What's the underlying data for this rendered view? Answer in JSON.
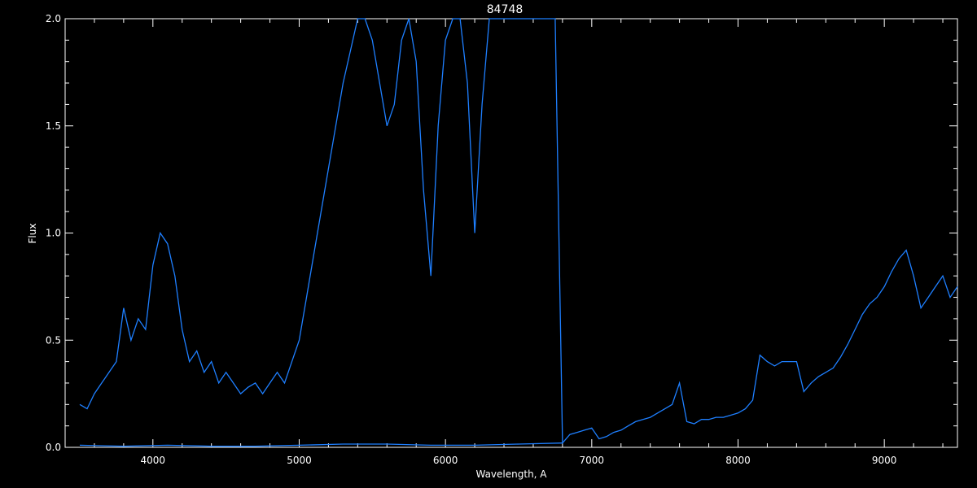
{
  "chart_data": {
    "type": "line",
    "title": "84748",
    "xlabel": "Wavelength, A",
    "ylabel": "Flux",
    "xlim": [
      3400,
      9500
    ],
    "ylim": [
      0,
      2.0
    ],
    "x_ticks": [
      4000,
      5000,
      6000,
      7000,
      8000,
      9000
    ],
    "x_tick_labels": [
      "4000",
      "5000",
      "6000",
      "7000",
      "8000",
      "9000"
    ],
    "y_ticks": [
      0.0,
      0.5,
      1.0,
      1.5,
      2.0
    ],
    "y_tick_labels": [
      "0.0",
      "0.5",
      "1.0",
      "1.5",
      "2.0"
    ],
    "grid": false,
    "background": "#000000",
    "axis_color": "#ffffff",
    "series": [
      {
        "color": "#1e7fff",
        "x": [
          3500,
          3550,
          3600,
          3650,
          3700,
          3750,
          3780,
          3800,
          3850,
          3900,
          3950,
          4000,
          4050,
          4100,
          4150,
          4200,
          4250,
          4300,
          4350,
          4400,
          4450,
          4500,
          4550,
          4600,
          4650,
          4700,
          4750,
          4800,
          4850,
          4900,
          4950,
          5000,
          5050,
          5100,
          5150,
          5200,
          5250,
          5300,
          5350,
          5400,
          5450,
          5500,
          5550,
          5600,
          5650,
          5700,
          5750,
          5800,
          5850,
          5900,
          5950,
          6000,
          6050,
          6100,
          6150,
          6200,
          6250,
          6300,
          6350,
          6400,
          6450,
          6500,
          6550,
          6600,
          6650,
          6700,
          6750,
          6800,
          6850,
          6900,
          6950,
          7000,
          7050,
          7100,
          7150,
          7200,
          7250,
          7300,
          7350,
          7400,
          7450,
          7500,
          7550,
          7600,
          7650,
          7700,
          7750,
          7800,
          7850,
          7900,
          7950,
          8000,
          8050,
          8100,
          8150,
          8200,
          8250,
          8300,
          8350,
          8400,
          8450,
          8500,
          8550,
          8600,
          8650,
          8700,
          8750,
          8800,
          8850,
          8900,
          8950,
          9000,
          9050,
          9100,
          9150,
          9200,
          9250,
          9300,
          9350,
          9400,
          9450,
          9500
        ],
        "y": [
          0.2,
          0.18,
          0.25,
          0.3,
          0.35,
          0.4,
          0.55,
          0.65,
          0.5,
          0.6,
          0.55,
          0.85,
          1.0,
          0.95,
          0.8,
          0.55,
          0.4,
          0.45,
          0.35,
          0.4,
          0.3,
          0.35,
          0.3,
          0.25,
          0.28,
          0.3,
          0.25,
          0.3,
          0.35,
          0.3,
          0.4,
          0.5,
          0.7,
          0.9,
          1.1,
          1.3,
          1.5,
          1.7,
          1.85,
          2.0,
          2.0,
          1.9,
          1.7,
          1.5,
          1.6,
          1.9,
          2.0,
          1.8,
          1.2,
          0.8,
          1.5,
          1.9,
          2.0,
          2.0,
          1.7,
          1.0,
          1.6,
          2.0,
          2.0,
          2.0,
          2.0,
          2.0,
          2.0,
          2.0,
          2.0,
          2.0,
          2.0,
          0.02,
          0.06,
          0.07,
          0.08,
          0.09,
          0.04,
          0.05,
          0.07,
          0.08,
          0.1,
          0.12,
          0.13,
          0.14,
          0.16,
          0.18,
          0.2,
          0.3,
          0.12,
          0.11,
          0.13,
          0.13,
          0.14,
          0.14,
          0.15,
          0.16,
          0.18,
          0.22,
          0.43,
          0.4,
          0.38,
          0.4,
          0.4,
          0.4,
          0.26,
          0.3,
          0.33,
          0.35,
          0.37,
          0.42,
          0.48,
          0.55,
          0.62,
          0.67,
          0.7,
          0.75,
          0.82,
          0.88,
          0.92,
          0.8,
          0.65,
          0.7,
          0.75,
          0.8,
          0.7,
          0.75
        ]
      },
      {
        "color": "#1e7fff",
        "x": [
          3500,
          3800,
          4100,
          4400,
          4700,
          5000,
          5300,
          5600,
          5900,
          6200,
          6500,
          6800
        ],
        "y": [
          0.01,
          0.005,
          0.01,
          0.005,
          0.005,
          0.01,
          0.015,
          0.015,
          0.01,
          0.01,
          0.015,
          0.02
        ]
      }
    ]
  }
}
